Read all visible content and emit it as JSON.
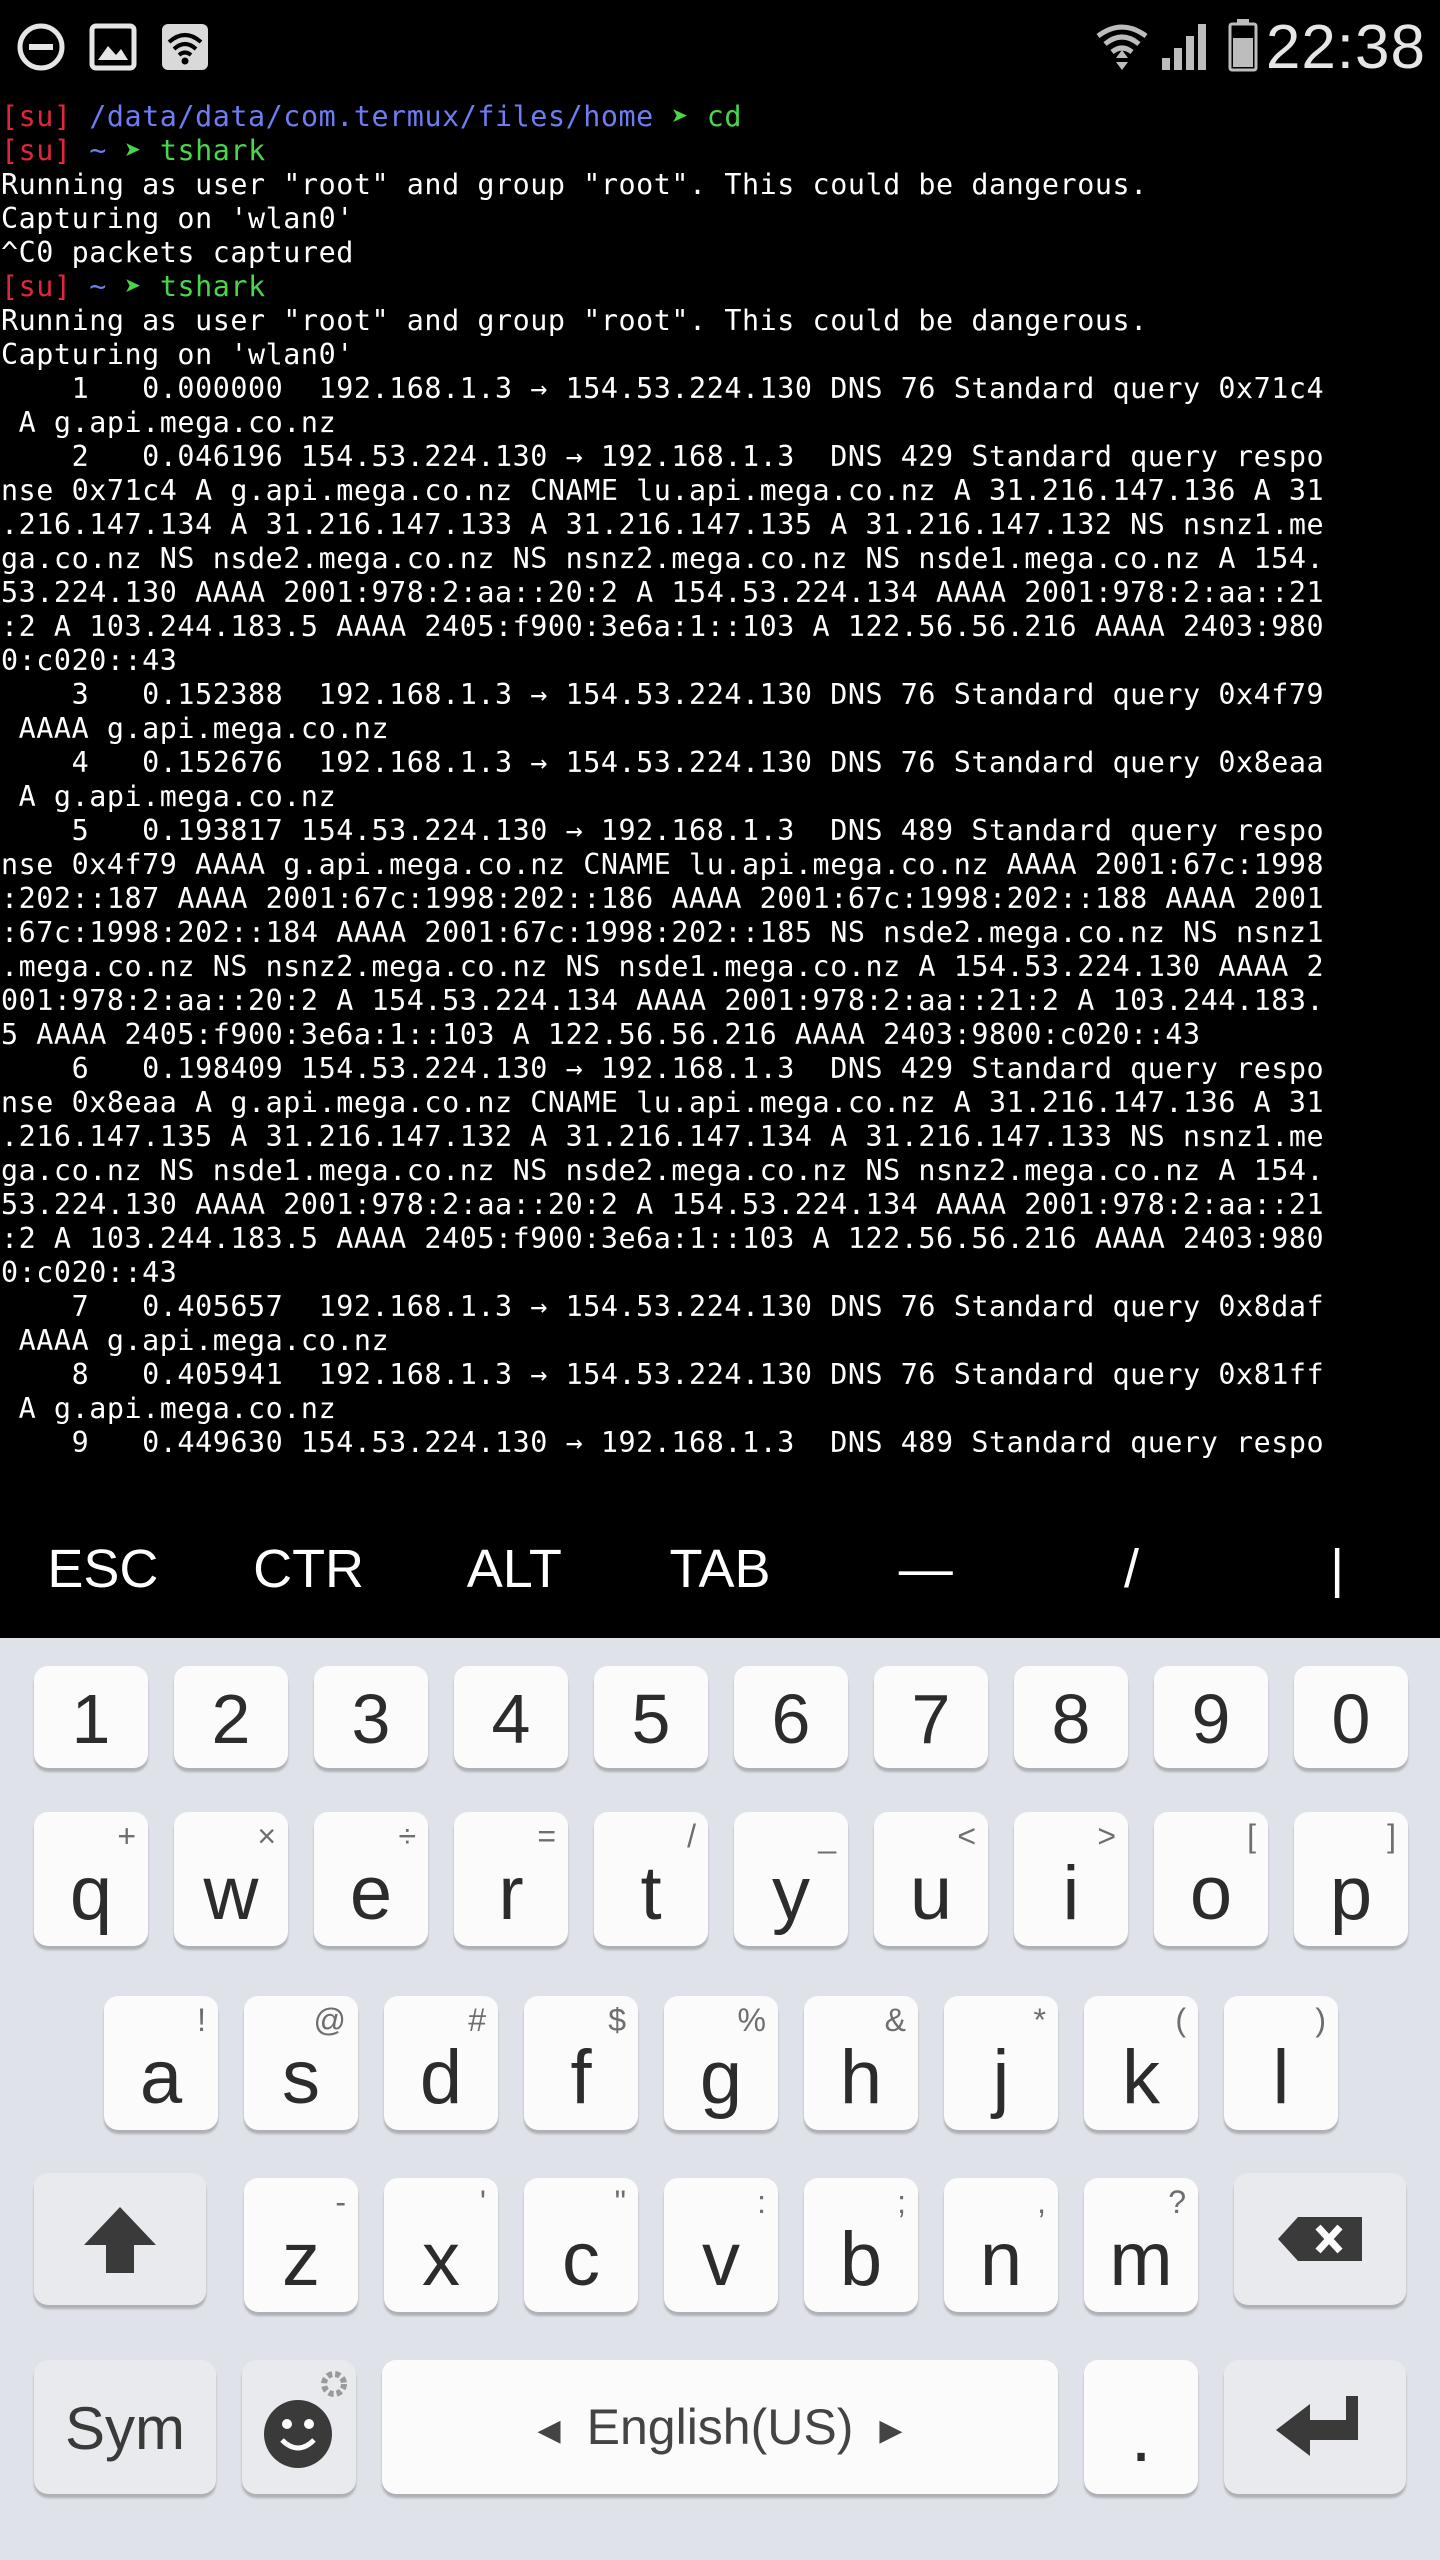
{
  "status_bar": {
    "time": "22:38",
    "left_icons": [
      "do-not-disturb-icon",
      "image-icon",
      "wifi-icon"
    ],
    "right_icons": [
      "wifi-signal-icon",
      "cellular-signal-icon",
      "battery-icon"
    ]
  },
  "terminal": {
    "prompts": [
      {
        "tag": "[su]",
        "path": "/data/data/com.termux/files/home",
        "arrow": "➤",
        "command": "cd"
      },
      {
        "tag": "[su]",
        "path": "~",
        "arrow": "➤",
        "command": "tshark"
      },
      {
        "tag": "[su]",
        "path": "~",
        "arrow": "➤",
        "command": "tshark"
      }
    ],
    "output_a": [
      "Running as user \"root\" and group \"root\". This could be dangerous.",
      "Capturing on 'wlan0'",
      "^C0 packets captured"
    ],
    "output_b": [
      "Running as user \"root\" and group \"root\". This could be dangerous.",
      "Capturing on 'wlan0'",
      "    1   0.000000  192.168.1.3 → 154.53.224.130 DNS 76 Standard query 0x71c4",
      " A g.api.mega.co.nz",
      "    2   0.046196 154.53.224.130 → 192.168.1.3  DNS 429 Standard query respo",
      "nse 0x71c4 A g.api.mega.co.nz CNAME lu.api.mega.co.nz A 31.216.147.136 A 31",
      ".216.147.134 A 31.216.147.133 A 31.216.147.135 A 31.216.147.132 NS nsnz1.me",
      "ga.co.nz NS nsde2.mega.co.nz NS nsnz2.mega.co.nz NS nsde1.mega.co.nz A 154.",
      "53.224.130 AAAA 2001:978:2:aa::20:2 A 154.53.224.134 AAAA 2001:978:2:aa::21",
      ":2 A 103.244.183.5 AAAA 2405:f900:3e6a:1::103 A 122.56.56.216 AAAA 2403:980",
      "0:c020::43",
      "    3   0.152388  192.168.1.3 → 154.53.224.130 DNS 76 Standard query 0x4f79",
      " AAAA g.api.mega.co.nz",
      "    4   0.152676  192.168.1.3 → 154.53.224.130 DNS 76 Standard query 0x8eaa",
      " A g.api.mega.co.nz",
      "    5   0.193817 154.53.224.130 → 192.168.1.3  DNS 489 Standard query respo",
      "nse 0x4f79 AAAA g.api.mega.co.nz CNAME lu.api.mega.co.nz AAAA 2001:67c:1998",
      ":202::187 AAAA 2001:67c:1998:202::186 AAAA 2001:67c:1998:202::188 AAAA 2001",
      ":67c:1998:202::184 AAAA 2001:67c:1998:202::185 NS nsde2.mega.co.nz NS nsnz1",
      ".mega.co.nz NS nsnz2.mega.co.nz NS nsde1.mega.co.nz A 154.53.224.130 AAAA 2",
      "001:978:2:aa::20:2 A 154.53.224.134 AAAA 2001:978:2:aa::21:2 A 103.244.183.",
      "5 AAAA 2405:f900:3e6a:1::103 A 122.56.56.216 AAAA 2403:9800:c020::43",
      "    6   0.198409 154.53.224.130 → 192.168.1.3  DNS 429 Standard query respo",
      "nse 0x8eaa A g.api.mega.co.nz CNAME lu.api.mega.co.nz A 31.216.147.136 A 31",
      ".216.147.135 A 31.216.147.132 A 31.216.147.134 A 31.216.147.133 NS nsnz1.me",
      "ga.co.nz NS nsde1.mega.co.nz NS nsde2.mega.co.nz NS nsnz2.mega.co.nz A 154.",
      "53.224.130 AAAA 2001:978:2:aa::20:2 A 154.53.224.134 AAAA 2001:978:2:aa::21",
      ":2 A 103.244.183.5 AAAA 2405:f900:3e6a:1::103 A 122.56.56.216 AAAA 2403:980",
      "0:c020::43",
      "    7   0.405657  192.168.1.3 → 154.53.224.130 DNS 76 Standard query 0x8daf",
      " AAAA g.api.mega.co.nz",
      "    8   0.405941  192.168.1.3 → 154.53.224.130 DNS 76 Standard query 0x81ff",
      " A g.api.mega.co.nz",
      "    9   0.449630 154.53.224.130 → 192.168.1.3  DNS 489 Standard query respo"
    ]
  },
  "extra_keys": [
    "ESC",
    "CTR",
    "ALT",
    "TAB",
    "—",
    "/",
    "|"
  ],
  "keyboard": {
    "numbers": [
      "1",
      "2",
      "3",
      "4",
      "5",
      "6",
      "7",
      "8",
      "9",
      "0"
    ],
    "row1": [
      {
        "main": "q",
        "sub": "+"
      },
      {
        "main": "w",
        "sub": "×"
      },
      {
        "main": "e",
        "sub": "÷"
      },
      {
        "main": "r",
        "sub": "="
      },
      {
        "main": "t",
        "sub": "/"
      },
      {
        "main": "y",
        "sub": "_"
      },
      {
        "main": "u",
        "sub": "<"
      },
      {
        "main": "i",
        "sub": ">"
      },
      {
        "main": "o",
        "sub": "["
      },
      {
        "main": "p",
        "sub": "]"
      }
    ],
    "row2": [
      {
        "main": "a",
        "sub": "!"
      },
      {
        "main": "s",
        "sub": "@"
      },
      {
        "main": "d",
        "sub": "#"
      },
      {
        "main": "f",
        "sub": "$"
      },
      {
        "main": "g",
        "sub": "%"
      },
      {
        "main": "h",
        "sub": "&"
      },
      {
        "main": "j",
        "sub": "*"
      },
      {
        "main": "k",
        "sub": "("
      },
      {
        "main": "l",
        "sub": ")"
      }
    ],
    "row3": [
      {
        "main": "z",
        "sub": "-"
      },
      {
        "main": "x",
        "sub": "'"
      },
      {
        "main": "c",
        "sub": "\""
      },
      {
        "main": "v",
        "sub": ":"
      },
      {
        "main": "b",
        "sub": ";"
      },
      {
        "main": "n",
        "sub": ","
      },
      {
        "main": "m",
        "sub": "?"
      }
    ],
    "sym_label": "Sym",
    "space_label": "English(US)",
    "period_label": "."
  }
}
